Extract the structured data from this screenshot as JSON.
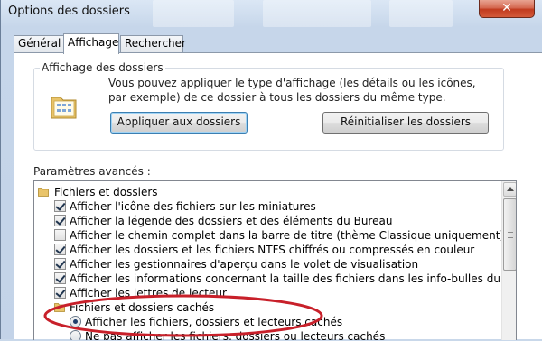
{
  "window": {
    "title": "Options des dossiers",
    "close_glyph": "✕"
  },
  "tabs": [
    {
      "label": "Général",
      "active": false
    },
    {
      "label": "Affichage",
      "active": true
    },
    {
      "label": "Rechercher",
      "active": false
    }
  ],
  "folder_view": {
    "legend": "Affichage des dossiers",
    "icon": "folder-view-icon",
    "description": "Vous pouvez appliquer le type d'affichage (les détails ou les icônes, par exemple) de ce dossier à tous les dossiers du même type.",
    "apply_button": "Appliquer aux dossiers",
    "reset_button": "Réinitialiser les dossiers"
  },
  "advanced": {
    "label": "Paramètres avancés :",
    "items": [
      {
        "kind": "folder",
        "label": "Fichiers et dossiers"
      },
      {
        "kind": "checkbox",
        "checked": true,
        "label": "Afficher l'icône des fichiers sur les miniatures"
      },
      {
        "kind": "checkbox",
        "checked": true,
        "label": "Afficher la légende des dossiers et des éléments du Bureau"
      },
      {
        "kind": "checkbox",
        "checked": false,
        "label": "Afficher le chemin complet dans la barre de titre (thème Classique uniquement)"
      },
      {
        "kind": "checkbox",
        "checked": true,
        "label": "Afficher les dossiers et les fichiers NTFS chiffrés ou compressés en couleur"
      },
      {
        "kind": "checkbox",
        "checked": true,
        "label": "Afficher les gestionnaires d'aperçu dans le volet de visualisation"
      },
      {
        "kind": "checkbox",
        "checked": true,
        "label": "Afficher les informations concernant la taille des fichiers dans les info-bulles du dossier"
      },
      {
        "kind": "checkbox",
        "checked": true,
        "label": "Afficher les lettres de lecteur"
      },
      {
        "kind": "subfolder",
        "label": "Fichiers et dossiers cachés"
      },
      {
        "kind": "radio",
        "checked": true,
        "label": "Afficher les fichiers, dossiers et lecteurs cachés"
      },
      {
        "kind": "radio",
        "checked": false,
        "label": "Ne pas afficher les fichiers, dossiers ou lecteurs cachés"
      }
    ]
  },
  "colors": {
    "annotation": "#c8202a",
    "accent": "#3c7fb1"
  }
}
